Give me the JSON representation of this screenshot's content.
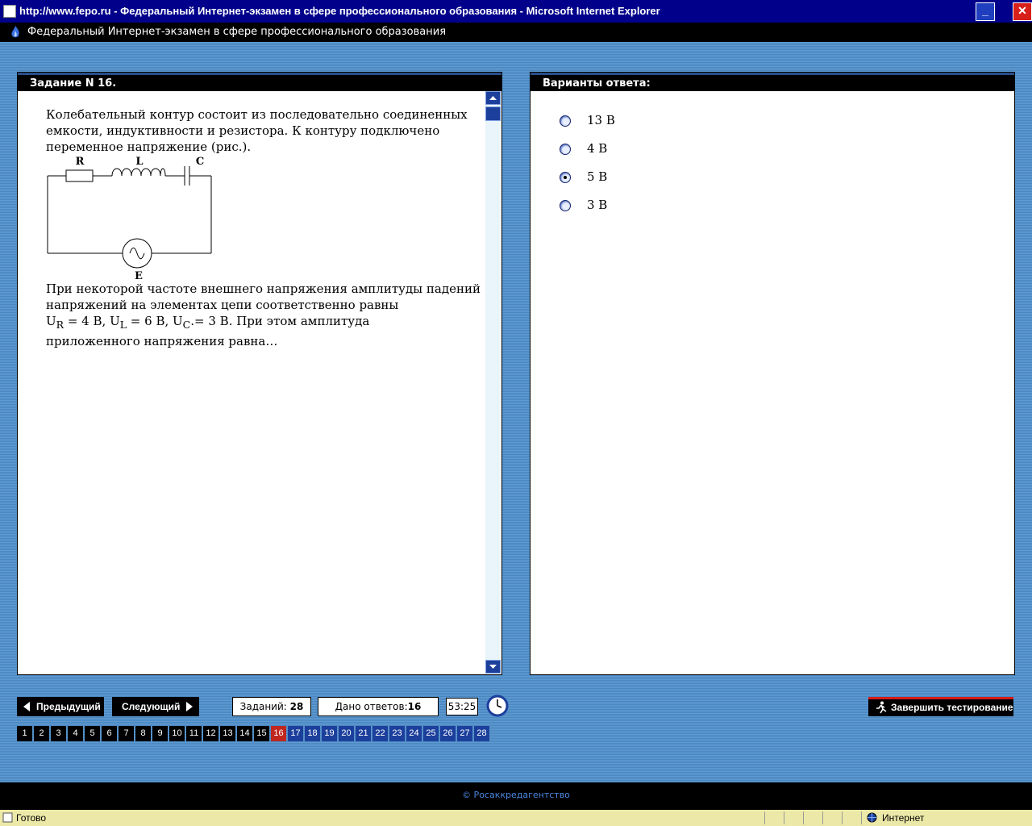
{
  "window": {
    "title": "http://www.fepo.ru - Федеральный Интернет-экзамен в сфере профессионального образования - Microsoft Internet Explorer",
    "minimize": "_",
    "close": "✕"
  },
  "app": {
    "title": "Федеральный Интернет-экзамен в сфере профессионального образования"
  },
  "task": {
    "header": "Задание N 16.",
    "intro": "Колебательный контур состоит из последовательно соединенных емкости, индуктивности и резистора. К контуру подключено переменное напряжение (рис.).",
    "circuit_labels": {
      "r": "R",
      "l": "L",
      "c": "C",
      "e": "E"
    },
    "body_line1": "При некоторой частоте внешнего напряжения амплитуды падений напряжений на элементах цепи соответственно равны",
    "u": "U",
    "sub_r": "R",
    "eq_r": " = 4 В, ",
    "sub_l": "L",
    "eq_l": " = 6 В, ",
    "sub_c": "C",
    "eq_c": ".= 3 В. При этом амплитуда",
    "body_line3": "приложенного напряжения равна…"
  },
  "answers": {
    "header": "Варианты ответа:",
    "options": [
      {
        "label": "13 В",
        "checked": false
      },
      {
        "label": "4 В",
        "checked": false
      },
      {
        "label": "5 В",
        "checked": true
      },
      {
        "label": "3 В",
        "checked": false
      }
    ]
  },
  "nav": {
    "prev": "Предыдущий",
    "next": "Следующий",
    "tasks_label": "Заданий:",
    "tasks_count": "28",
    "answered_label": "Дано ответов:",
    "answered_count": "16",
    "timer": "53:25",
    "finish": "Завершить тестирование"
  },
  "pager": {
    "pages": [
      "1",
      "2",
      "3",
      "4",
      "5",
      "6",
      "7",
      "8",
      "9",
      "10",
      "11",
      "12",
      "13",
      "14",
      "15",
      "16",
      "17",
      "18",
      "19",
      "20",
      "21",
      "22",
      "23",
      "24",
      "25",
      "26",
      "27",
      "28"
    ],
    "current": "16"
  },
  "footer": {
    "copyright": "© Росаккредагентство"
  },
  "status": {
    "text": "Готово",
    "zone": "Интернет"
  }
}
